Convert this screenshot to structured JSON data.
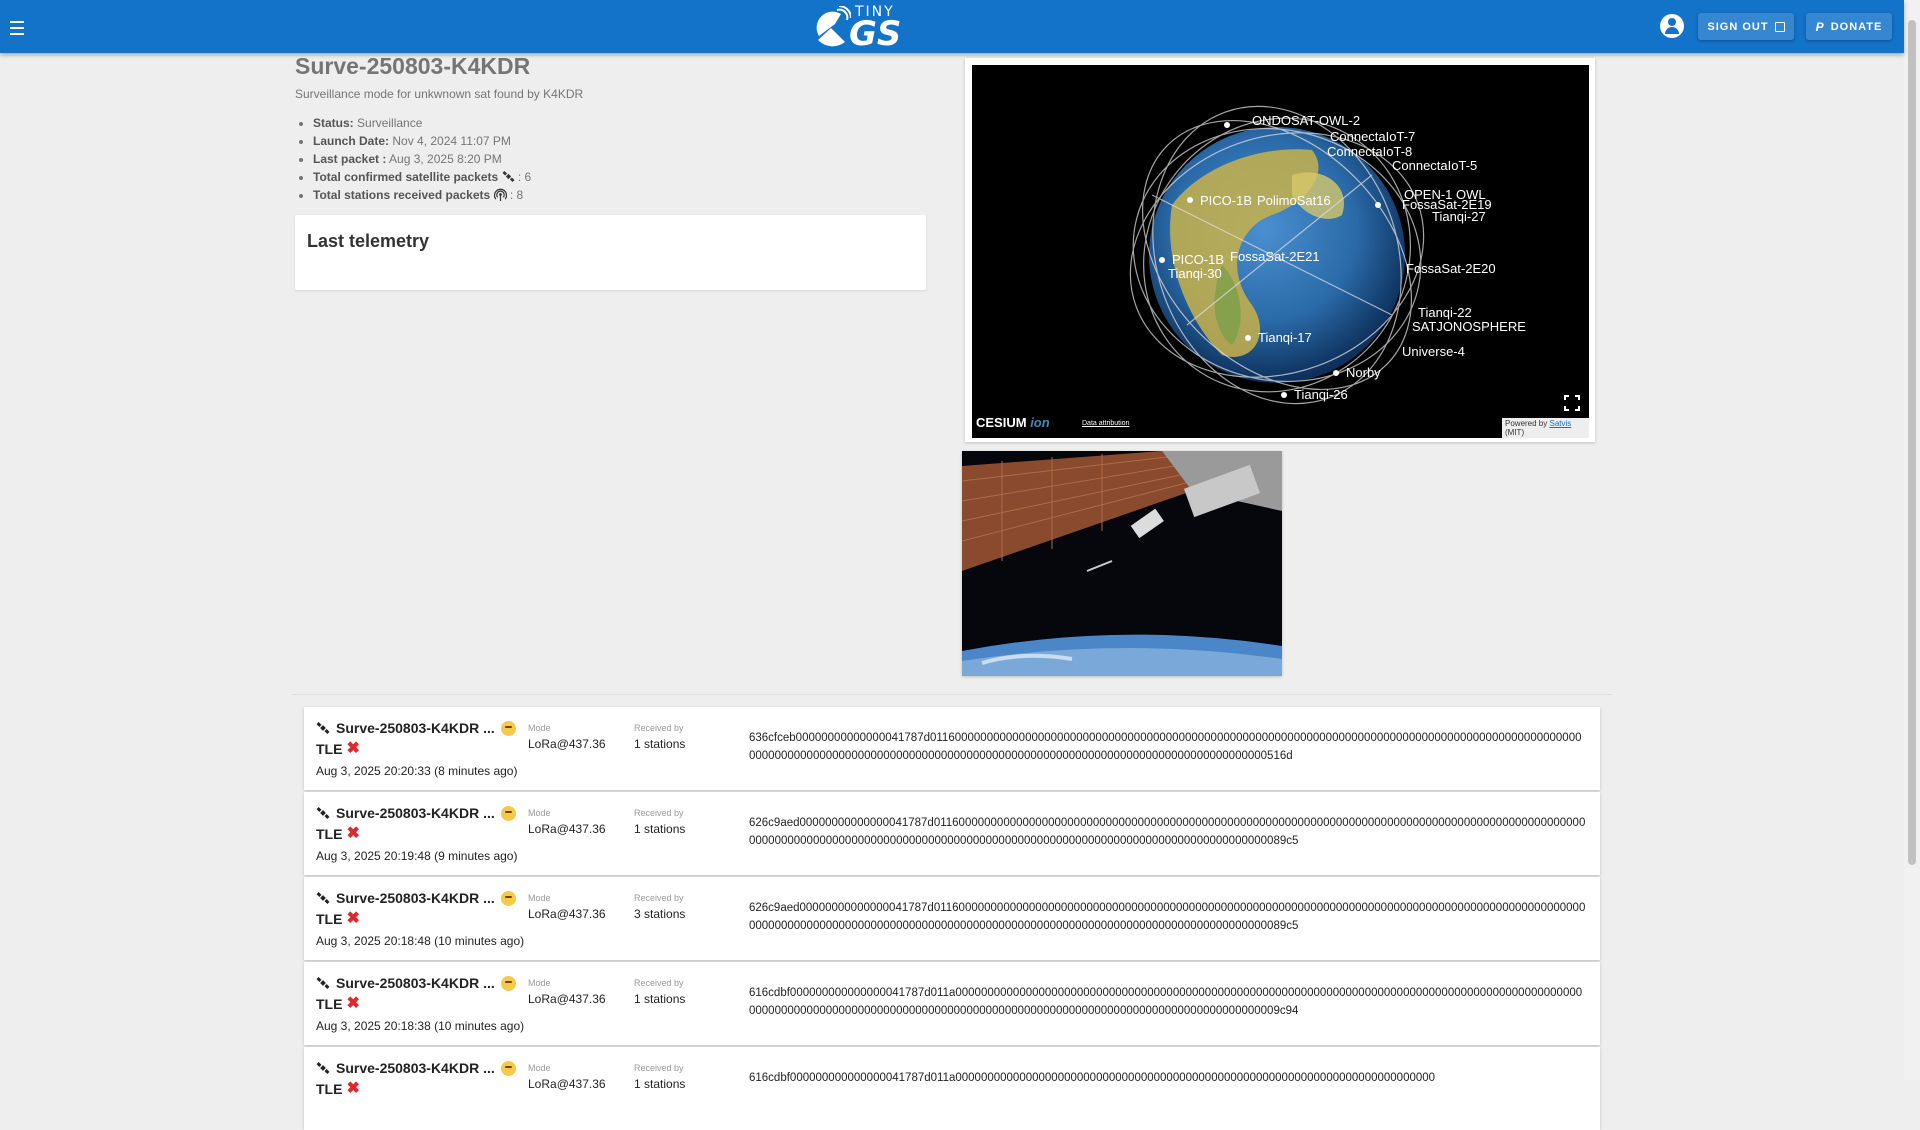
{
  "header": {
    "logo_top": "TINY",
    "logo_main": "GS",
    "signout_label": "SIGN OUT",
    "donate_label": "DONATE"
  },
  "satellite": {
    "title": "Surve-250803-K4KDR",
    "subtitle": "Surveillance mode for unkwnown sat found by K4KDR",
    "status_label": "Status:",
    "status_value": "Surveillance",
    "launch_label": "Launch Date:",
    "launch_value": "Nov 4, 2024 11:07 PM",
    "last_packet_label": "Last packet :",
    "last_packet_value": "Aug 3, 2025 8:20 PM",
    "confirmed_label": "Total confirmed satellite packets",
    "confirmed_value": ": 6",
    "stations_label": "Total stations received packets",
    "stations_value": ": 8"
  },
  "telemetry": {
    "title": "Last telemetry"
  },
  "globe": {
    "cesium_label": "CESIUM",
    "cesium_ion": "ion",
    "data_attribution": "Data attribution",
    "powered_prefix": "Powered by",
    "powered_link": "Satvis",
    "powered_suffix": "(MIT)",
    "sat_labels": [
      "ONDOSAT-OWL-2",
      "ConnectaIoT-7",
      "ConnectaIoT-8",
      "ConnectaIoT-5",
      "PICO-1B",
      "PolimoSat16",
      "Tianqi-27",
      "FossaSat-2E19",
      "PICO-1B",
      "FossaSat-2E21",
      "Tianqi-30",
      "FossaSat-2E20",
      "Tianqi-22",
      "SATJONOSPHERE",
      "Tianqi-17",
      "Norby",
      "Tianqi-26",
      "Universe-4",
      "OPEN-1 OWL"
    ]
  },
  "packets": [
    {
      "name": "Surve-250803-K4KDR ...",
      "tle": "TLE",
      "date": "Aug 3, 2025 20:20:33 (8 minutes ago)",
      "mode_label": "Mode",
      "mode": "LoRa@437.36",
      "received_label": "Received by",
      "received": "1 stations",
      "hex": "636cfceb00000000000000041787d011600000000000000000000000000000000000000000000000000000000000000000000000000000000000000000000000000000000000000000000000000000000000000000000000000000000000000000000000000000000000516d"
    },
    {
      "name": "Surve-250803-K4KDR ...",
      "tle": "TLE",
      "date": "Aug 3, 2025 20:19:48 (9 minutes ago)",
      "mode_label": "Mode",
      "mode": "LoRa@437.36",
      "received_label": "Received by",
      "received": "1 stations",
      "hex": "626c9aed00000000000000041787d011600000000000000000000000000000000000000000000000000000000000000000000000000000000000000000000000000000000000000000000000000000000000000000000000000000000000000000000000000000000000089c5"
    },
    {
      "name": "Surve-250803-K4KDR ...",
      "tle": "TLE",
      "date": "Aug 3, 2025 20:18:48 (10 minutes ago)",
      "mode_label": "Mode",
      "mode": "LoRa@437.36",
      "received_label": "Received by",
      "received": "3 stations",
      "hex": "626c9aed00000000000000041787d011600000000000000000000000000000000000000000000000000000000000000000000000000000000000000000000000000000000000000000000000000000000000000000000000000000000000000000000000000000000000089c5"
    },
    {
      "name": "Surve-250803-K4KDR ...",
      "tle": "TLE",
      "date": "Aug 3, 2025 20:18:38 (10 minutes ago)",
      "mode_label": "Mode",
      "mode": "LoRa@437.36",
      "received_label": "Received by",
      "received": "1 stations",
      "hex": "616cdbf000000000000000041787d011a0000000000000000000000000000000000000000000000000000000000000000000000000000000000000000000000000000000000000000000000000000000000000000000000000000000000000000000000000000000000009c94"
    },
    {
      "name": "Surve-250803-K4KDR ...",
      "tle": "TLE",
      "date": "",
      "mode_label": "Mode",
      "mode": "LoRa@437.36",
      "received_label": "Received by",
      "received": "1 stations",
      "hex": "616cdbf000000000000000041787d011a000000000000000000000000000000000000000000000000000000000000000000000000000"
    }
  ],
  "colors": {
    "toolbar": "#1373c9",
    "background": "#eeeeee",
    "error": "#e0282f"
  }
}
